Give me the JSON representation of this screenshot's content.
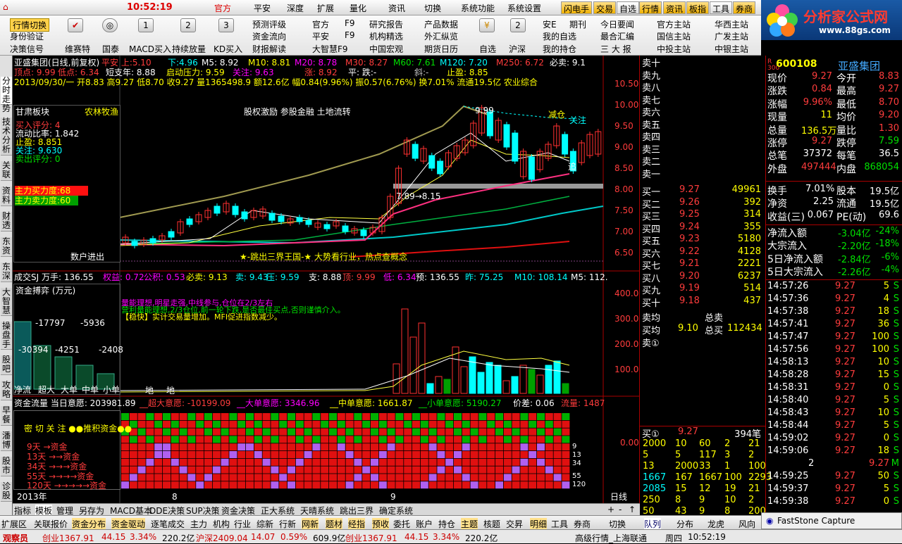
{
  "menubar": {
    "left": "行情切换",
    "time": "10:52:19",
    "items": [
      "官方",
      "平安",
      "深度",
      "扩展",
      "量化",
      "资讯",
      "切换",
      "系统功能",
      "系统设置"
    ],
    "tabs": [
      "闪电手",
      "交易",
      "自选",
      "行情",
      "资讯",
      "板指",
      "工具",
      "券商"
    ]
  },
  "toolbar": {
    "row1": [
      "预测评级",
      "官方",
      "F9",
      "研究报告",
      "产品数据",
      "安E",
      "期刊",
      "今日要闻",
      "官方主站",
      "华西主站"
    ],
    "row2": [
      "资金流向",
      "平安",
      "F9",
      "机构精选",
      "外汇纵览",
      "我的自选",
      "最合汇编",
      "国信主站",
      "广发主站"
    ],
    "row3": [
      "财报解读",
      "大智慧F9",
      "中国宏观",
      "期货日历",
      "我的持仓",
      "三 大 报",
      "中投主站",
      "中银主站",
      "切十档框",
      "数据"
    ],
    "icons": [
      "行情切换",
      "身份验证",
      "决策信号",
      "维赛特",
      "国泰",
      "MACD买入",
      "持续放量",
      "KD买入",
      "自选",
      "沪深"
    ],
    "iconnums": [
      "1",
      "2",
      "3",
      "2"
    ]
  },
  "logo": {
    "brand": "分析家公式网",
    "url": "www.88gs.com"
  },
  "leftstrip": [
    "分时走势",
    "技术分析",
    "关联",
    "资料",
    "财透",
    "东资",
    "东深",
    "大智慧",
    "操盘手",
    "股吧",
    "攻略",
    "早餐",
    "潘博",
    "股市",
    "诊股"
  ],
  "chart_head": {
    "name": "亚盛集团(日线,前复权)",
    "ping": "平安 上:5.10",
    "xia": "下:4.96",
    "m5": "M5: 8.92",
    "m10": "M10: 8.81",
    "m20": "M20: 8.78",
    "m30": "M30: 8.27",
    "m60": "M60: 7.61",
    "m120": "M120: 7.20",
    "m250": "M250: 6.72",
    "bimai": "必卖: 9.1",
    "l2a": "顶点: 9.99",
    "l2b": "低点: 6.34",
    "l2c": "短支年: 8.88",
    "l2d": "启动压力: 9.59",
    "l2e": "关注: 9.63",
    "l2f": "涨: 8.92",
    "l2g": "平: 跌:-",
    "l2h": "斜:-",
    "l2i": "止盈: 8.85",
    "l3": "2013/09/30/一 开8.83 高9.27 低8.70 收9.27 量1365498.9 额12.6亿 幅0.84(9.96%) 振0.57(6.76%) 换7.01% 流通19.5亿 农业综合"
  },
  "leftbox1": {
    "title": "甘肃板块",
    "title2": "农林牧渔",
    "l1": "买入评分: 4",
    "l2": "流动比率: 1.842",
    "l3": "止盈: 8.851",
    "l4": "关注: 9.630",
    "l5": "卖出评分: 0",
    "b1": "主力买力度:68",
    "b2": "主力卖力度:60",
    "b3": "数户进出"
  },
  "main_anno": {
    "a1": "股权激励 参股金融 土地流转",
    "a2": "★-跳出三界王国-★  大势看行业，热点查概念",
    "a3": "7.89→8.15",
    "a4": "9.99",
    "a5": "减仓",
    "a6": "关注",
    "a7": "追"
  },
  "price_axis": [
    "10.50",
    "10.00",
    "9.50",
    "9.00",
    "8.50",
    "8.00",
    "7.50",
    "7.00",
    "6.50"
  ],
  "vol_head": {
    "a": "成交SJ 万手: 136.55",
    "b": "权益: 0.72",
    "c": "公积: 0.53",
    "d": "必卖: 9.13",
    "e": "卖: 9.43",
    "f": "压: 9.59",
    "g": "支: 8.88",
    "h": "顶: 9.99",
    "i": "低: 6.34",
    "j": "预: 136.55",
    "k": "昨: 75.25",
    "l": "M10: 108.14",
    "m": "M5: 112."
  },
  "vol_anno": {
    "a1": "量能理想,明星走强,中线参与,仓位在2/3左右",
    "a2": "营利量能理想,2/3仓位,前一轮下跌,是否最佳买点,否则谨慎介入。",
    "a3": "【稳快】实计交易量增加。MFI促进指数减少。"
  },
  "vol_axis": [
    "400.0",
    "300.0",
    "200.0",
    "100.0"
  ],
  "leftbox2": {
    "title": "资金搏弈 (万元)",
    "v1": "-17797",
    "v2": "-5936",
    "v3": "-30394",
    "v4": "-4251",
    "v5": "-2408",
    "lbl": [
      "净流",
      "超大",
      "大单",
      "中单",
      "小单"
    ]
  },
  "vol_bottom": [
    "地",
    "地"
  ],
  "flow_head": {
    "a": "资金流量 当日意愿: 203981.89",
    "b": "__超大意愿: -10199.09",
    "c": "__大单意愿: 3346.96",
    "d": "__中单意愿: 1661.87",
    "e": "__小单意愿: 5190.27",
    "f": "价差: 0.06",
    "g": "流量: 1487"
  },
  "leftbox3": {
    "title": "密 切 关 注 ●●推积资金●●",
    "r1": "9天 →资金",
    "r2": "13天 →→资金",
    "r3": "34天 →→→资金",
    "r4": "55天 →→→→资金",
    "r5": "120天 →→→→→资金"
  },
  "flow_axis": "0.00",
  "flow_right": [
    "9",
    "13",
    "34",
    "55",
    "120"
  ],
  "dates": {
    "y": "2013年",
    "m1": "8",
    "m2": "9",
    "period": "日线"
  },
  "orderbook": {
    "sells_labels": [
      "卖十",
      "卖九",
      "卖八",
      "卖七",
      "卖六",
      "卖五",
      "卖四",
      "卖三",
      "卖二",
      "卖一"
    ],
    "buys": [
      [
        "买一",
        "9.27",
        "49961"
      ],
      [
        "买二",
        "9.26",
        "392"
      ],
      [
        "买三",
        "9.25",
        "314"
      ],
      [
        "买四",
        "9.24",
        "355"
      ],
      [
        "买五",
        "9.23",
        "5180"
      ],
      [
        "买六",
        "9.22",
        "4128"
      ],
      [
        "买七",
        "9.21",
        "2221"
      ],
      [
        "买八",
        "9.20",
        "6237"
      ],
      [
        "买九",
        "9.19",
        "514"
      ],
      [
        "买十",
        "9.18",
        "437"
      ]
    ],
    "avg1": "卖均",
    "avg2": "总卖",
    "avg3": "买均",
    "avg4": "9.10",
    "avg5": "总买",
    "avg6": "112434",
    "sell1": "卖①",
    "buy1": "买①",
    "buy1p": "9.27",
    "buy1v": "394笔",
    "queue": [
      [
        "2000",
        "10",
        "60",
        "2",
        "21"
      ],
      [
        "5",
        "5",
        "117",
        "3",
        "2"
      ],
      [
        "13",
        "2000",
        "33",
        "1",
        "100"
      ],
      [
        "1667",
        "167",
        "1667",
        "100",
        "2293"
      ],
      [
        "2085",
        "15",
        "12",
        "19",
        "21"
      ],
      [
        "250",
        "8",
        "9",
        "10",
        "2"
      ],
      [
        "50",
        "43",
        "9",
        "8",
        "200"
      ]
    ]
  },
  "quote": {
    "code": "600108",
    "name": "亚盛集团",
    "flag": "R 300",
    "rows": [
      [
        "现价",
        "9.27",
        "今开",
        "8.83"
      ],
      [
        "涨跌",
        "0.84",
        "最高",
        "9.27"
      ],
      [
        "涨幅",
        "9.96%",
        "最低",
        "8.70"
      ],
      [
        "现量",
        "11",
        "均价",
        "9.20"
      ],
      [
        "总量",
        "136.5万",
        "量比",
        "1.30"
      ],
      [
        "涨停",
        "9.27",
        "跌停",
        "7.59"
      ],
      [
        "总笔",
        "37372",
        "每笔",
        "36.5"
      ],
      [
        "外盘",
        "497444",
        "内盘",
        "868054"
      ]
    ],
    "rows2": [
      [
        "换手",
        "7.01%",
        "股本",
        "19.5亿"
      ],
      [
        "净资",
        "2.25",
        "流通",
        "19.5亿"
      ],
      [
        "收益(三)",
        "0.067",
        "PE(动)",
        "69.6"
      ]
    ],
    "flows": [
      [
        "净流入额",
        "-3.04亿",
        "-24%"
      ],
      [
        "大宗流入",
        "-2.20亿",
        "-18%"
      ],
      [
        "5日净流入额",
        "-2.84亿",
        "-6%"
      ],
      [
        "5日大宗流入",
        "-2.26亿",
        "-4%"
      ]
    ],
    "ticks": [
      [
        "14:57:26",
        "9.27",
        "5",
        "S"
      ],
      [
        "14:57:36",
        "9.27",
        "4",
        "S"
      ],
      [
        "14:57:38",
        "9.27",
        "18",
        "S"
      ],
      [
        "14:57:41",
        "9.27",
        "36",
        "S"
      ],
      [
        "14:57:47",
        "9.27",
        "100",
        "S"
      ],
      [
        "14:57:56",
        "9.27",
        "100",
        "S"
      ],
      [
        "14:58:13",
        "9.27",
        "10",
        "S"
      ],
      [
        "14:58:28",
        "9.27",
        "15",
        "S"
      ],
      [
        "14:58:31",
        "9.27",
        "0",
        "S"
      ],
      [
        "14:58:40",
        "9.27",
        "5",
        "S"
      ],
      [
        "14:58:43",
        "9.27",
        "10",
        "S"
      ],
      [
        "14:58:44",
        "9.27",
        "5",
        "S"
      ],
      [
        "14:59:02",
        "9.27",
        "0",
        "S"
      ],
      [
        "14:59:06",
        "9.27",
        "18",
        "S"
      ],
      [
        "",
        "2",
        "9.27",
        "M"
      ],
      [
        "14:59:25",
        "9.27",
        "50",
        "S"
      ],
      [
        "14:59:37",
        "9.27",
        "5",
        "S"
      ],
      [
        "14:59:38",
        "9.27",
        "0",
        "S"
      ]
    ]
  },
  "bottabs": [
    "指标",
    "模板",
    "管理",
    "另存为",
    "MACD基本",
    "DDE决策",
    "SUP决策",
    "资金决策",
    "正大系统",
    "天晴系统",
    "跳出三界",
    "确定系统"
  ],
  "botbar": [
    "扩展区",
    "关联报价",
    "资金分布",
    "资金驱动",
    "逐笔成交",
    "主力",
    "机构",
    "行业",
    "综新",
    "行新",
    "网新",
    "题材",
    "经指",
    "预收",
    "委托",
    "账户",
    "持仓",
    "主题",
    "核题",
    "交昇",
    "明细",
    "工具",
    "券商",
    "切换"
  ],
  "botright": [
    "队列",
    "分布",
    "龙虎",
    "风向"
  ],
  "statusbar": {
    "a": "观察员",
    "b": "创业1367.91",
    "c": "44.15",
    "d": "3.34%",
    "e": "220.2亿",
    "f": "沪深2409.04",
    "g": "14.07",
    "h": "0.59%",
    "i": "609.9亿",
    "j": "创业1367.91",
    "k": "44.15",
    "l": "3.34%",
    "m": "220.2亿",
    "n": "高级行情_上海联通",
    "o": "周四",
    "p": "10:52:19",
    "fs": "FastStone Capture"
  }
}
